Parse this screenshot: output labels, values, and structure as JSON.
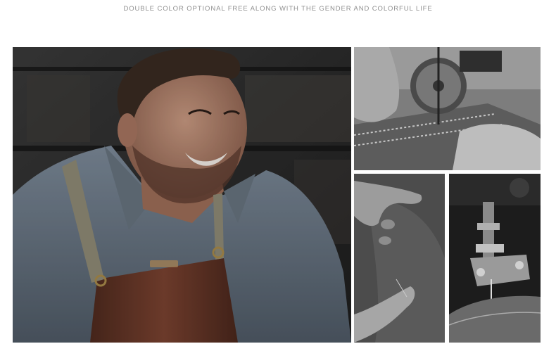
{
  "header": {
    "tagline": "DOUBLE COLOR OPTIONAL FREE ALONG WITH THE GENDER AND COLORFUL LIFE"
  },
  "photos": [
    {
      "name": "craftsman-portrait-photo",
      "description_icon": "person-apron-image"
    },
    {
      "name": "stitching-machine-closeup-photo",
      "description_icon": "sewing-wheel-image"
    },
    {
      "name": "hand-folding-leather-photo",
      "description_icon": "hand-leather-image"
    },
    {
      "name": "sewing-machine-foot-photo",
      "description_icon": "presser-foot-image"
    }
  ],
  "colors": {
    "apron_leather": "#6b3a2a",
    "shirt": "#6f7d8c",
    "background": "#ffffff",
    "tagline": "#8f8f8f"
  }
}
